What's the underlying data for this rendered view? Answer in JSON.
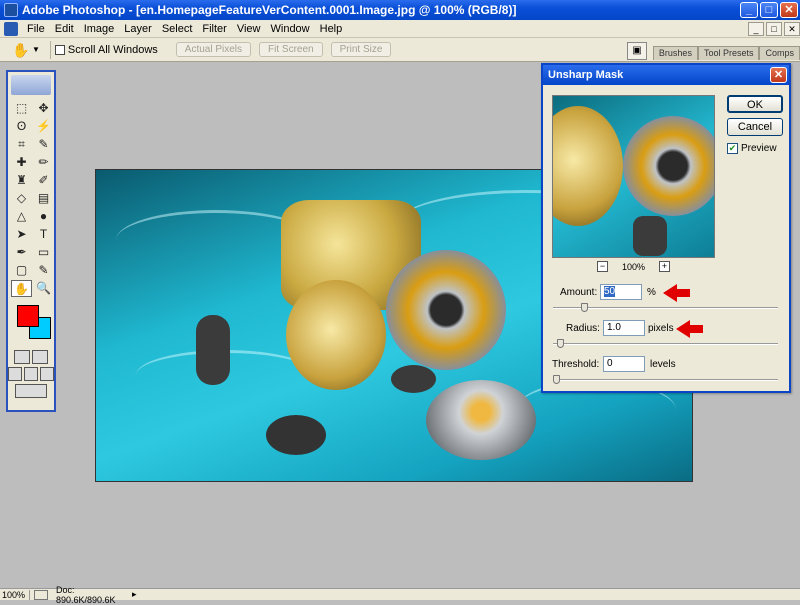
{
  "window": {
    "title": "Adobe Photoshop - [en.HomepageFeatureVerContent.0001.Image.jpg @ 100% (RGB/8)]",
    "min": "_",
    "max": "□",
    "close": "✕"
  },
  "menu": [
    "File",
    "Edit",
    "Image",
    "Layer",
    "Select",
    "Filter",
    "View",
    "Window",
    "Help"
  ],
  "mdi_controls": [
    "_",
    "□",
    "✕"
  ],
  "options": {
    "scroll_all": "Scroll All Windows",
    "actual_pixels": "Actual Pixels",
    "fit_screen": "Fit Screen",
    "print_size": "Print Size"
  },
  "palette_tabs": [
    "Brushes",
    "Tool Presets",
    "Comps"
  ],
  "toolbox": {
    "foreground": "#ff0000",
    "background": "#00ccff"
  },
  "dialog": {
    "title": "Unsharp Mask",
    "ok": "OK",
    "cancel": "Cancel",
    "preview_label": "Preview",
    "preview_checked": true,
    "zoom": "100%",
    "zoom_out": "−",
    "zoom_in": "+",
    "amount_label": "Amount:",
    "amount_value": "50",
    "amount_unit": "%",
    "amount_level": 0.13,
    "radius_label": "Radius:",
    "radius_value": "1.0",
    "radius_unit": "pixels",
    "radius_level": 0.02,
    "threshold_label": "Threshold:",
    "threshold_value": "0",
    "threshold_unit": "levels",
    "threshold_level": 0.0
  },
  "status": {
    "zoom": "100%",
    "doc": "Doc: 890.6K/890.6K",
    "arrow": "▸"
  }
}
